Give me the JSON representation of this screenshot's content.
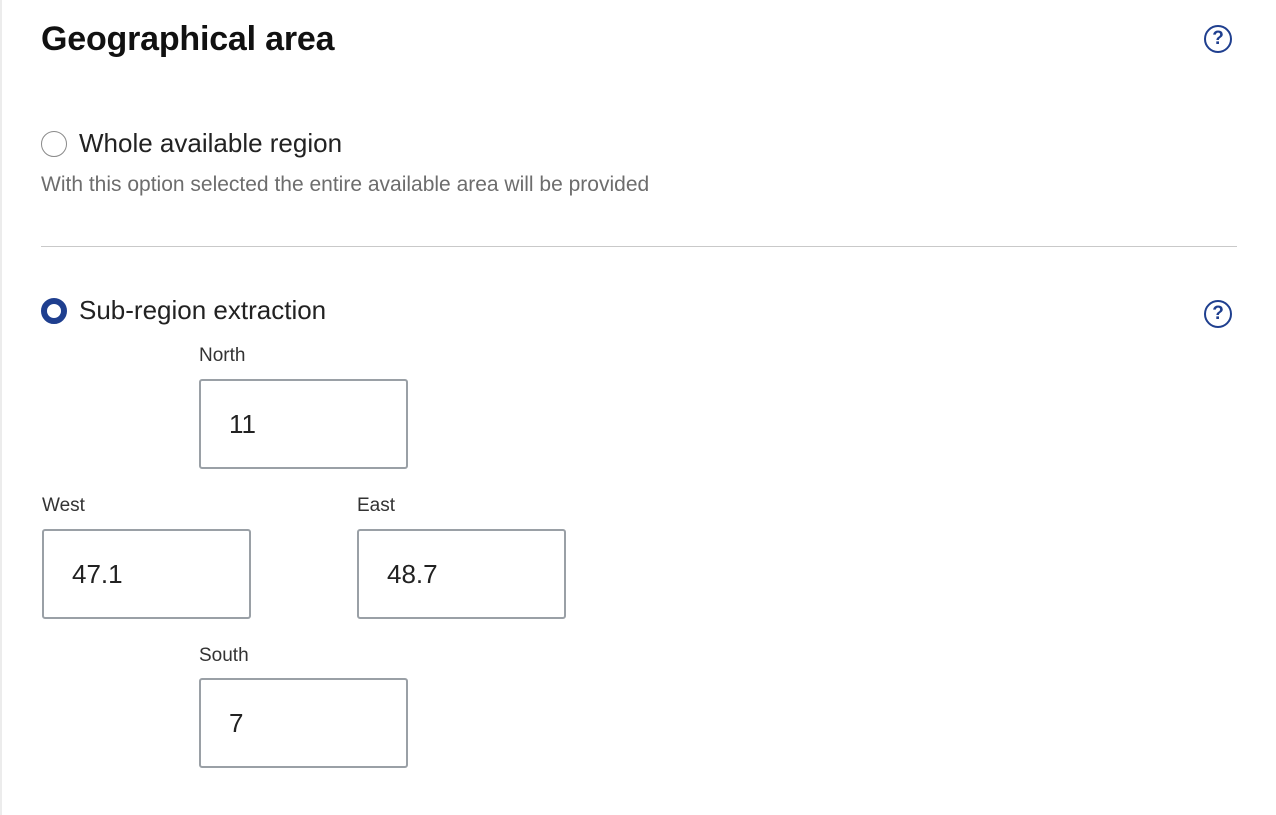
{
  "section": {
    "title": "Geographical area"
  },
  "help": {
    "glyph": "?",
    "color": "#1f3f8f"
  },
  "options": [
    {
      "label": "Whole available region",
      "description": "With this option selected the entire available area will be provided",
      "selected": false
    },
    {
      "label": "Sub-region extraction",
      "selected": true
    }
  ],
  "subregion": {
    "north": {
      "label": "North",
      "value": "11"
    },
    "west": {
      "label": "West",
      "value": "47.1"
    },
    "east": {
      "label": "East",
      "value": "48.7"
    },
    "south": {
      "label": "South",
      "value": "7"
    }
  }
}
